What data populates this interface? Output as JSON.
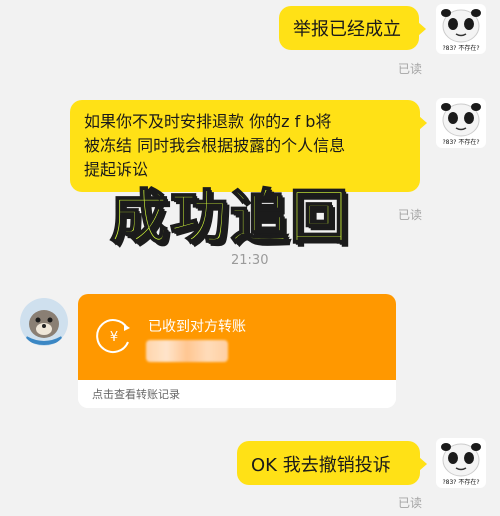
{
  "messages": [
    {
      "id": "m1",
      "sender": "me",
      "text": "举报已经成立",
      "status": "已读"
    },
    {
      "id": "m2",
      "sender": "me",
      "lines": [
        "如果你不及时安排退款  你的z f b将",
        "被冻结  同时我会根据披露的个人信息",
        "提起诉讼"
      ],
      "status": "已读"
    },
    {
      "id": "m3",
      "sender": "me",
      "text": "OK  我去撤销投诉",
      "status": "已读"
    }
  ],
  "my_avatar": {
    "caption": "?83? 不存在?",
    "icon": "panda-meme-icon"
  },
  "other_avatar": {
    "icon": "seal-mascot-icon"
  },
  "timestamp": "21:30",
  "overlay_caption": "成功追回",
  "transfer_card": {
    "title": "已收到对方转账",
    "amount_hidden": true,
    "link_text": "点击查看转账记录",
    "icon": "yuan-circle-icon",
    "accent_color": "#ff9800"
  },
  "colors": {
    "bubble": "#ffe116",
    "background": "#f2f2f2",
    "read_status": "#a5a5a5"
  }
}
